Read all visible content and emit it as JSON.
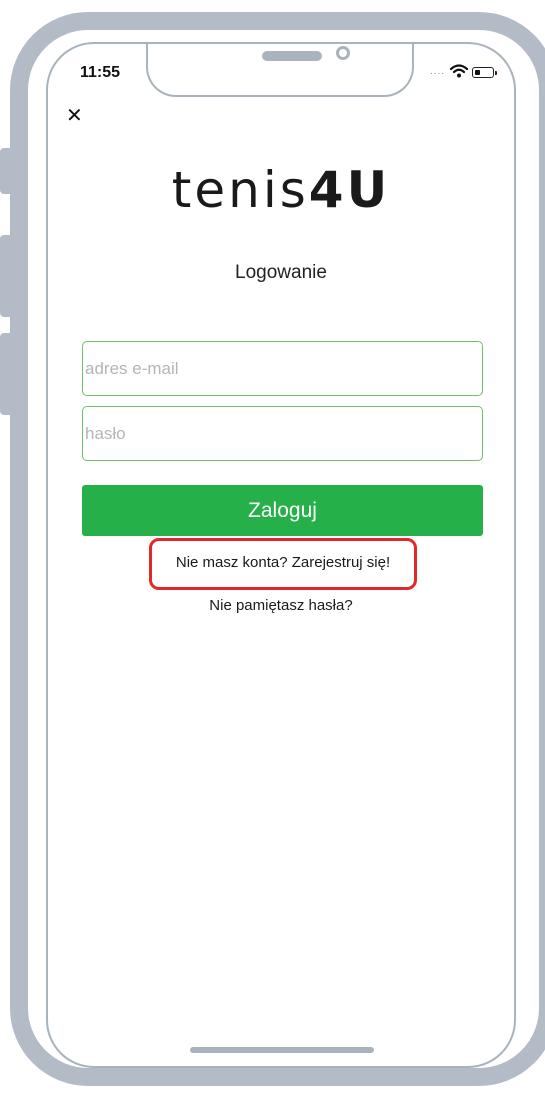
{
  "status_bar": {
    "time": "11:55",
    "signal": "....",
    "wifi_icon": "wifi-icon",
    "battery_icon": "battery-icon"
  },
  "header": {
    "close_icon": "close-icon",
    "close_glyph": "✕"
  },
  "logo": {
    "thin_part": "tenis",
    "bold_part": "4U"
  },
  "login": {
    "title": "Logowanie",
    "email_placeholder": "adres e-mail",
    "email_value": "",
    "password_placeholder": "hasło",
    "password_value": "",
    "submit_label": "Zaloguj",
    "register_link": "Nie masz konta? Zarejestruj się!",
    "forgot_link": "Nie pamiętasz hasła?"
  },
  "colors": {
    "accent_green": "#25b04a",
    "input_border_green": "#6cc36b",
    "highlight_red": "#e2282a",
    "frame_grey": "#b3bcc6"
  }
}
